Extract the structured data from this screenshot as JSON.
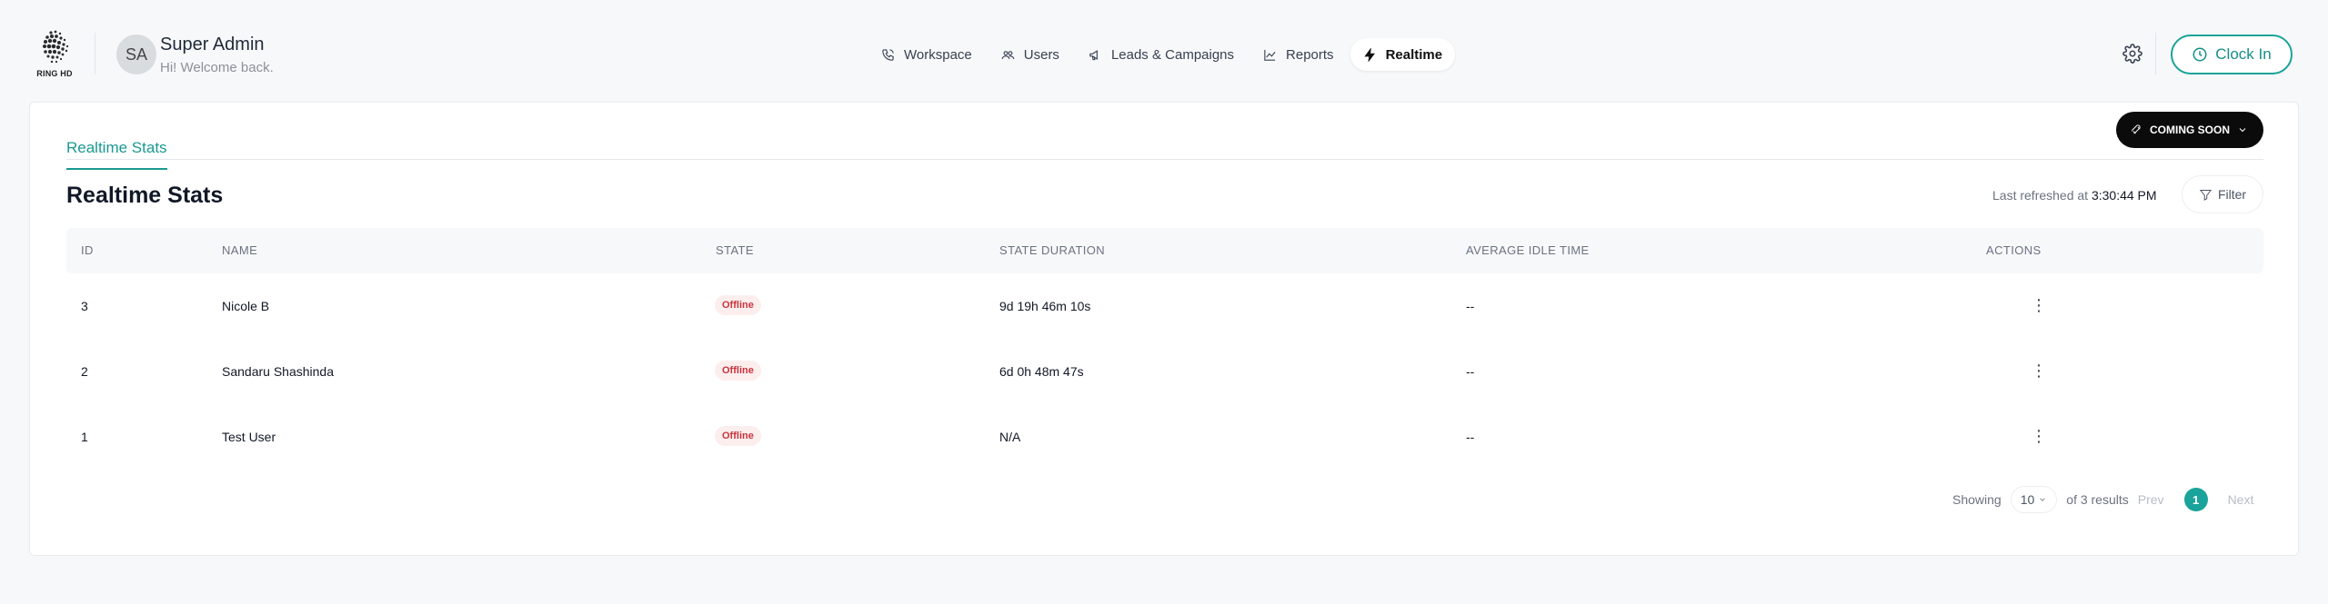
{
  "brand": {
    "logo_text": "RING HD"
  },
  "user": {
    "initials": "SA",
    "name": "Super Admin",
    "greeting": "Hi! Welcome back."
  },
  "nav": {
    "items": [
      {
        "label": "Workspace",
        "icon": "phone-icon"
      },
      {
        "label": "Users",
        "icon": "users-icon"
      },
      {
        "label": "Leads & Campaigns",
        "icon": "megaphone-icon"
      },
      {
        "label": "Reports",
        "icon": "chart-line-icon"
      },
      {
        "label": "Realtime",
        "icon": "lightning-icon",
        "active": true
      }
    ]
  },
  "header_actions": {
    "settings_icon": "gear-icon",
    "clock_in_label": "Clock In"
  },
  "tabs": [
    {
      "label": "Realtime Stats",
      "active": true
    }
  ],
  "coming_soon": {
    "label": "COMING SOON"
  },
  "section": {
    "title": "Realtime Stats",
    "refreshed_label": "Last refreshed at",
    "refreshed_time": "3:30:44 PM",
    "filter_label": "Filter"
  },
  "table": {
    "columns": [
      "ID",
      "NAME",
      "STATE",
      "STATE DURATION",
      "AVERAGE IDLE TIME",
      "ACTIONS"
    ],
    "rows": [
      {
        "id": "3",
        "name": "Nicole B",
        "state": "Offline",
        "duration": "9d 19h 46m 10s",
        "idle": "--"
      },
      {
        "id": "2",
        "name": "Sandaru Shashinda",
        "state": "Offline",
        "duration": "6d 0h 48m 47s",
        "idle": "--"
      },
      {
        "id": "1",
        "name": "Test User",
        "state": "Offline",
        "duration": "N/A",
        "idle": "--"
      }
    ]
  },
  "pagination": {
    "showing_label": "Showing",
    "page_size": "10",
    "results_label": "of 3 results",
    "prev_label": "Prev",
    "current_page": "1",
    "next_label": "Next"
  },
  "colors": {
    "accent": "#1aa39a",
    "badge_bg": "#fdeeee",
    "badge_text": "#c8343d",
    "dark_button": "#0b0b0b"
  }
}
